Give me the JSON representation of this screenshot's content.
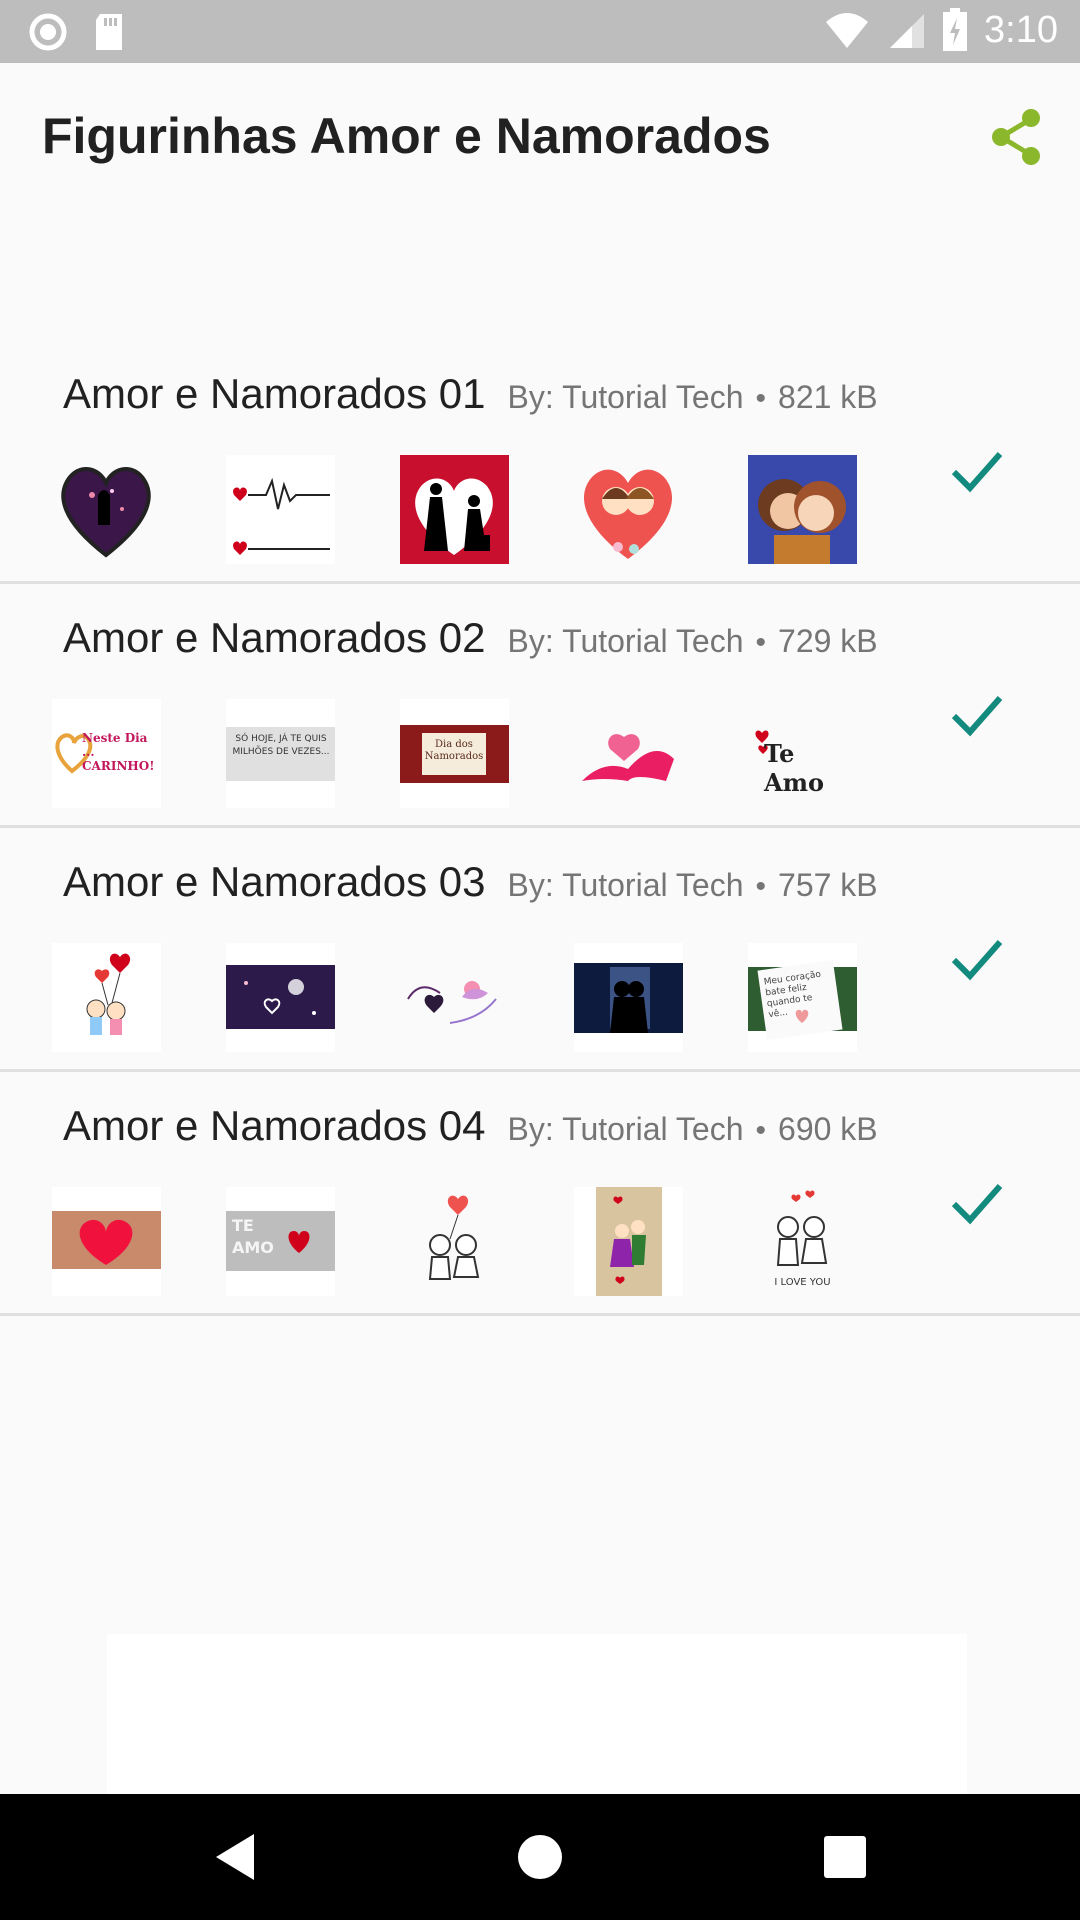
{
  "status_bar": {
    "time": "3:10"
  },
  "app_bar": {
    "title": "Figurinhas Amor e Namorados"
  },
  "colors": {
    "accent": "#8bb72c",
    "check": "#138a7e"
  },
  "packs": [
    {
      "name": "Amor e Namorados 01",
      "publisher": "By: Tutorial Tech",
      "size": "821 kB"
    },
    {
      "name": "Amor e Namorados 02",
      "publisher": "By: Tutorial Tech",
      "size": "729 kB"
    },
    {
      "name": "Amor e Namorados 03",
      "publisher": "By: Tutorial Tech",
      "size": "757 kB"
    },
    {
      "name": "Amor e Namorados 04",
      "publisher": "By: Tutorial Tech",
      "size": "690 kB"
    }
  ],
  "sticker_texts": {
    "p2_s1": "Neste Dia ... CARINHO!",
    "p2_s2": "SÓ HOJE, JÁ TE QUIS MILHÕES DE VEZES...",
    "p2_s3": "Dia dos Namorados",
    "p2_s5": "Te Amo",
    "p3_s5": "Meu coração bate feliz quando te vê...",
    "p4_s2": "TE AMO",
    "p4_s5": "I LOVE YOU"
  },
  "icons": {
    "share": "share-icon",
    "check": "check-icon",
    "back": "back-triangle-icon",
    "home": "home-circle-icon",
    "recents": "recents-square-icon"
  }
}
